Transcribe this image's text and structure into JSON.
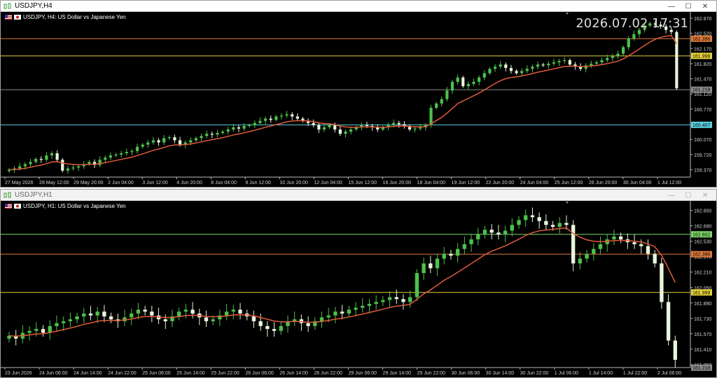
{
  "window_top": {
    "title": "USDJPY,H4",
    "header": "USDJPY, H4:  US Dollar vs Japanese Yen",
    "clock": "2026.07.02 17:31",
    "y_labels": [
      "162.870",
      "162.520",
      "162.170",
      "161.820",
      "161.470",
      "161.120",
      "160.770",
      "160.420",
      "160.070",
      "159.720",
      "159.370"
    ],
    "x_labels": [
      "27 May 2026",
      "28 May 12:00",
      "29 May 20:00",
      "2 Jun 04:00",
      "3 Jun 12:00",
      "4 Jun 20:00",
      "8 Jun 04:00",
      "9 Jun 12:00",
      "10 Jun 20:00",
      "12 Jun 04:00",
      "15 Jun 12:00",
      "16 Jun 20:00",
      "18 Jun 04:00",
      "19 Jun 12:00",
      "22 Jun 20:00",
      "24 Jun 04:00",
      "25 Jun 12:00",
      "26 Jun 20:00",
      "30 Jun 04:00",
      "1 Jul 12:00"
    ],
    "levels": [
      {
        "label": "162.396",
        "color": "#e07b39"
      },
      {
        "label": "161.999",
        "color": "#e6d33a"
      },
      {
        "label": "161.218",
        "color": "#8a8a8a"
      },
      {
        "label": "160.407",
        "color": "#5ad2e0"
      }
    ]
  },
  "window_bottom": {
    "title": "USDJPY,H1",
    "header": "USDJPY, H1:  US Dollar vs Japanese Yen",
    "y_labels": [
      "162.850",
      "162.690",
      "162.530",
      "162.370",
      "162.210",
      "162.050",
      "161.890",
      "161.730",
      "161.570",
      "161.410",
      "161.250"
    ],
    "x_labels": [
      "23 Jun 2026",
      "24 Jun 06:00",
      "24 Jun 14:00",
      "24 Jun 22:00",
      "25 Jun 06:00",
      "25 Jun 14:00",
      "25 Jun 22:00",
      "26 Jun 06:00",
      "26 Jun 14:00",
      "26 Jun 22:00",
      "29 Jun 06:00",
      "29 Jun 14:00",
      "29 Jun 22:00",
      "30 Jun 06:00",
      "30 Jun 14:00",
      "30 Jun 22:00",
      "1 Jul 06:00",
      "1 Jul 14:00",
      "1 Jul 22:00",
      "2 Jul 06:00"
    ],
    "levels": [
      {
        "label": "162.602",
        "color": "#7bd86a"
      },
      {
        "label": "162.396",
        "color": "#e07b39"
      },
      {
        "label": "161.999",
        "color": "#e6d33a"
      },
      {
        "label": "161.218",
        "color": "#8a8a8a"
      }
    ]
  },
  "chart_data": [
    {
      "type": "candlestick",
      "symbol": "USDJPY",
      "timeframe": "H4",
      "ylim": [
        159.2,
        162.95
      ],
      "ma_color": "#e05a3a",
      "up_color": "#4cc24a",
      "down_color": "#e8f5dc",
      "closes": [
        159.37,
        159.4,
        159.45,
        159.5,
        159.55,
        159.62,
        159.6,
        159.7,
        159.75,
        159.6,
        159.35,
        159.4,
        159.42,
        159.45,
        159.5,
        159.55,
        159.48,
        159.6,
        159.65,
        159.7,
        159.72,
        159.75,
        159.78,
        159.8,
        159.9,
        159.95,
        160.0,
        160.05,
        160.0,
        160.1,
        160.12,
        160.05,
        159.95,
        160.0,
        160.05,
        160.1,
        160.15,
        160.2,
        160.18,
        160.22,
        160.25,
        160.3,
        160.35,
        160.32,
        160.38,
        160.4,
        160.45,
        160.5,
        160.55,
        160.52,
        160.6,
        160.62,
        160.65,
        160.6,
        160.55,
        160.5,
        160.45,
        160.4,
        160.3,
        160.35,
        160.4,
        160.3,
        160.2,
        160.25,
        160.3,
        160.35,
        160.4,
        160.38,
        160.35,
        160.3,
        160.35,
        160.4,
        160.45,
        160.42,
        160.38,
        160.3,
        160.32,
        160.35,
        160.4,
        160.8,
        160.9,
        161.0,
        161.2,
        161.4,
        161.5,
        161.3,
        161.35,
        161.4,
        161.5,
        161.6,
        161.7,
        161.75,
        161.8,
        161.72,
        161.65,
        161.6,
        161.65,
        161.7,
        161.75,
        161.8,
        161.78,
        161.82,
        161.85,
        161.88,
        161.9,
        161.8,
        161.75,
        161.7,
        161.78,
        161.82,
        161.85,
        161.9,
        161.95,
        162.0,
        162.05,
        162.2,
        162.4,
        162.5,
        162.6,
        162.7,
        162.75,
        162.72,
        162.68,
        162.6,
        162.55,
        161.25
      ]
    },
    {
      "type": "candlestick",
      "symbol": "USDJPY",
      "timeframe": "H1",
      "ylim": [
        161.22,
        162.92
      ],
      "ma_color": "#e05a3a",
      "up_color": "#4cc24a",
      "down_color": "#e8f5dc",
      "closes": [
        161.55,
        161.52,
        161.58,
        161.6,
        161.62,
        161.58,
        161.65,
        161.68,
        161.7,
        161.72,
        161.75,
        161.78,
        161.76,
        161.8,
        161.75,
        161.72,
        161.7,
        161.74,
        161.78,
        161.82,
        161.8,
        161.76,
        161.72,
        161.7,
        161.75,
        161.8,
        161.82,
        161.78,
        161.74,
        161.7,
        161.72,
        161.76,
        161.8,
        161.82,
        161.78,
        161.75,
        161.7,
        161.65,
        161.62,
        161.6,
        161.65,
        161.7,
        161.72,
        161.68,
        161.65,
        161.7,
        161.74,
        161.76,
        161.8,
        161.78,
        161.82,
        161.84,
        161.86,
        161.88,
        161.9,
        161.92,
        161.95,
        161.93,
        161.9,
        161.95,
        162.2,
        162.3,
        162.25,
        162.35,
        162.4,
        162.38,
        162.45,
        162.5,
        162.55,
        162.6,
        162.65,
        162.62,
        162.6,
        162.64,
        162.7,
        162.75,
        162.8,
        162.78,
        162.74,
        162.7,
        162.68,
        162.72,
        162.7,
        162.3,
        162.35,
        162.4,
        162.45,
        162.5,
        162.55,
        162.58,
        162.55,
        162.52,
        162.5,
        162.48,
        162.4,
        162.3,
        161.9,
        161.5,
        161.3
      ]
    }
  ]
}
